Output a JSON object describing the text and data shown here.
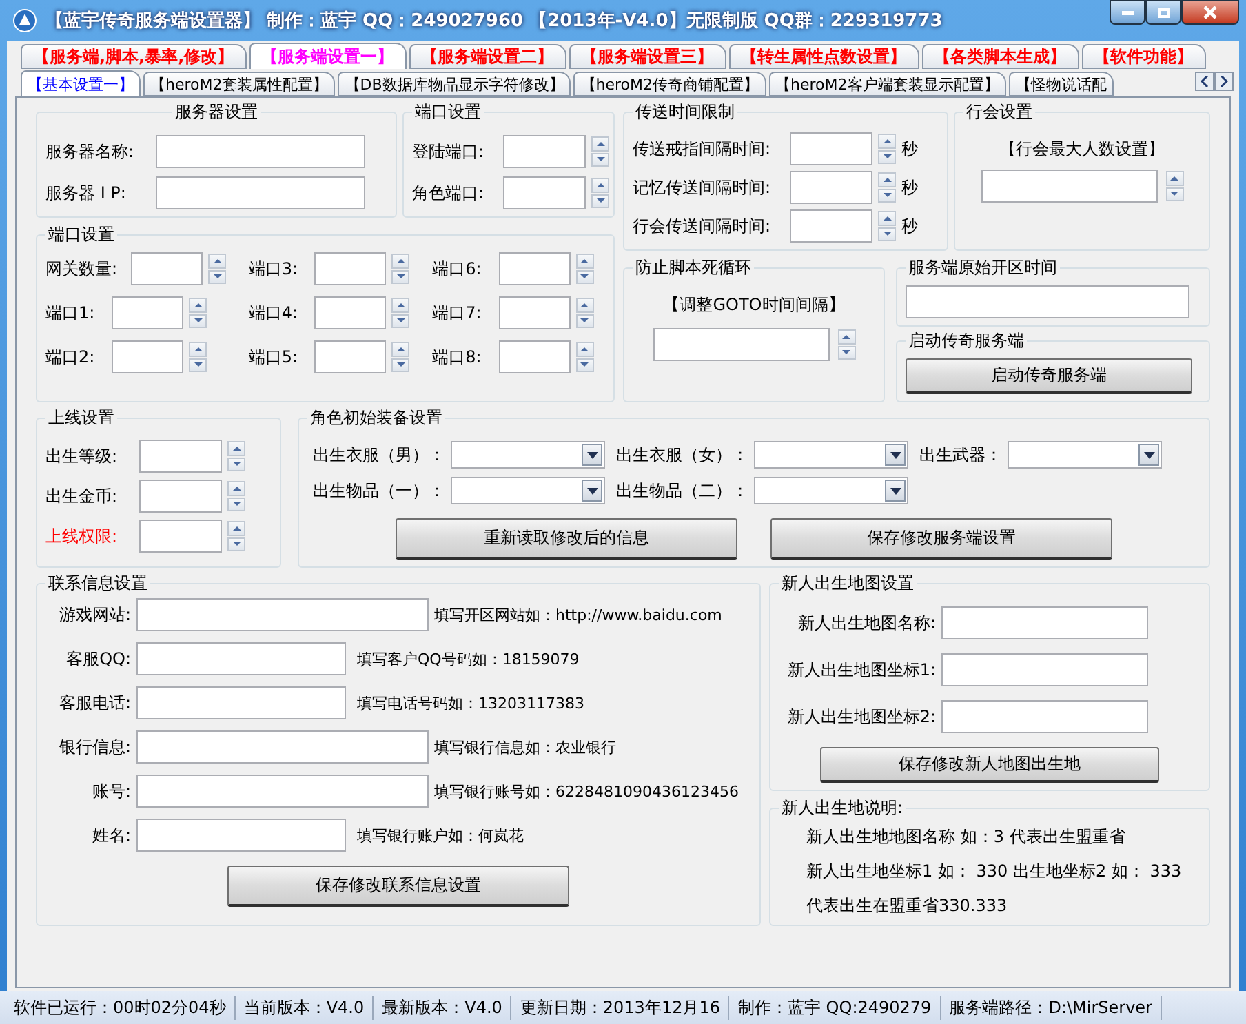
{
  "window": {
    "title": "【蓝宇传奇服务端设置器】 制作：蓝宇 QQ：249027960 【2013年-V4.0】无限制版 QQ群：229319773"
  },
  "tabs": [
    {
      "label": "【服务端,脚本,暴率,修改】",
      "selected": false
    },
    {
      "label": "【服务端设置一】",
      "selected": true
    },
    {
      "label": "【服务端设置二】",
      "selected": false
    },
    {
      "label": "【服务端设置三】",
      "selected": false
    },
    {
      "label": "【转生属性点数设置】",
      "selected": false
    },
    {
      "label": "【各类脚本生成】",
      "selected": false
    },
    {
      "label": "【软件功能】",
      "selected": false
    }
  ],
  "subtabs": [
    {
      "label": "【基本设置一】",
      "selected": true
    },
    {
      "label": "【heroM2套装属性配置】",
      "selected": false
    },
    {
      "label": "【DB数据库物品显示字符修改】",
      "selected": false
    },
    {
      "label": "【heroM2传奇商铺配置】",
      "selected": false
    },
    {
      "label": "【heroM2客户端套装显示配置】",
      "selected": false
    },
    {
      "label": "【怪物说话配",
      "selected": false
    }
  ],
  "server_settings": {
    "title": "服务器设置",
    "fields": [
      {
        "label": "服务器名称:"
      },
      {
        "label": "服务器 I P:"
      }
    ]
  },
  "login_ports": {
    "title": "端口设置",
    "fields": [
      {
        "label": "登陆端口:"
      },
      {
        "label": "角色端口:"
      }
    ]
  },
  "gateway_ports": {
    "title": "端口设置",
    "fields": [
      {
        "label": "网关数量:"
      },
      {
        "label": "端口1:"
      },
      {
        "label": "端口2:"
      },
      {
        "label": "端口3:"
      },
      {
        "label": "端口4:"
      },
      {
        "label": "端口5:"
      },
      {
        "label": "端口6:"
      },
      {
        "label": "端口7:"
      },
      {
        "label": "端口8:"
      }
    ]
  },
  "transfer_limits": {
    "title": "传送时间限制",
    "fields": [
      {
        "label": "传送戒指间隔时间:",
        "unit": "秒"
      },
      {
        "label": "记忆传送间隔时间:",
        "unit": "秒"
      },
      {
        "label": "行会传送间隔时间:",
        "unit": "秒"
      }
    ]
  },
  "guild": {
    "title": "行会设置",
    "caption": "【行会最大人数设置】"
  },
  "loop_guard": {
    "title": "防止脚本死循环",
    "caption": "【调整GOTO时间间隔】"
  },
  "open_time": {
    "title": "服务端原始开区时间"
  },
  "launch": {
    "title": "启动传奇服务端",
    "button": "启动传奇服务端"
  },
  "login_settings": {
    "title": "上线设置",
    "fields": [
      {
        "label": "出生等级:",
        "highlight": false
      },
      {
        "label": "出生金币:",
        "highlight": false
      },
      {
        "label": "上线权限:",
        "highlight": true
      }
    ]
  },
  "equipment": {
    "title": "角色初始装备设置",
    "dropdowns": [
      {
        "label": "出生衣服（男）："
      },
      {
        "label": "出生衣服（女）："
      },
      {
        "label": "出生武器："
      },
      {
        "label": "出生物品（一）："
      },
      {
        "label": "出生物品（二）："
      }
    ],
    "buttons": [
      "重新读取修改后的信息",
      "保存修改服务端设置"
    ]
  },
  "contact": {
    "title": "联系信息设置",
    "fields": [
      {
        "label": "游戏网站:",
        "kind": "long",
        "hint": "填写开区网站如：http://www.baidu.com"
      },
      {
        "label": "客服QQ:",
        "kind": "short",
        "hint": "填写客户QQ号码如：18159079"
      },
      {
        "label": "客服电话:",
        "kind": "short",
        "hint": "填写电话号码如：13203117383"
      },
      {
        "label": "银行信息:",
        "kind": "long",
        "hint": "填写银行信息如：农业银行"
      },
      {
        "label": "账号:",
        "kind": "long",
        "hint": "填写银行账号如：6228481090436123456"
      },
      {
        "label": "姓名:",
        "kind": "short",
        "hint": "填写银行账户如：何岚花"
      }
    ],
    "button": "保存修改联系信息设置"
  },
  "birth_map": {
    "title": "新人出生地图设置",
    "fields": [
      {
        "label": "新人出生地图名称:"
      },
      {
        "label": "新人出生地图坐标1:"
      },
      {
        "label": "新人出生地图坐标2:"
      }
    ],
    "button": "保存修改新人地图出生地"
  },
  "birth_note": {
    "title": "新人出生地说明:",
    "lines": [
      "新人出生地地图名称 如：3 代表出生盟重省",
      "新人出生地坐标1 如： 330  出生地坐标2 如： 333",
      "代表出生在盟重省330.333"
    ]
  },
  "status_bar": [
    "软件已运行：00时02分04秒",
    "当前版本：V4.0",
    "最新版本：V4.0",
    "更新日期：2013年12月16",
    "制作：蓝宇 QQ:2490279",
    "服务端路径：D:\\MirServer"
  ]
}
